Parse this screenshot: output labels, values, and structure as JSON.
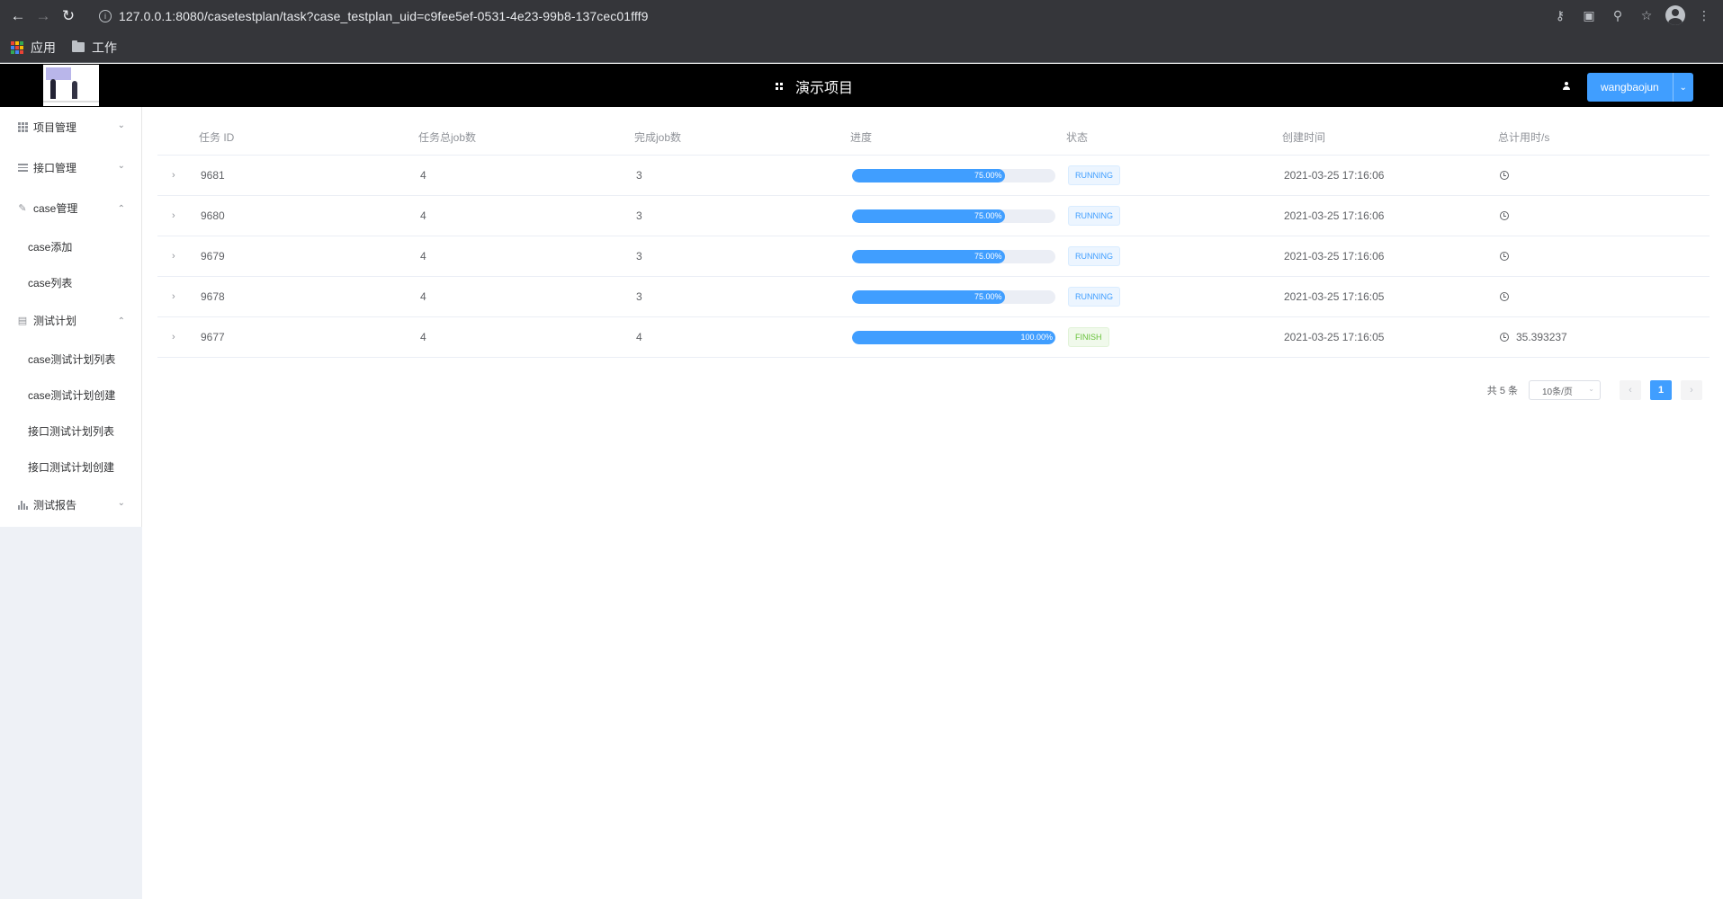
{
  "browser": {
    "url": "127.0.0.1:8080/casetestplan/task?case_testplan_uid=c9fee5ef-0531-4e23-99b8-137cec01fff9",
    "bookmarks": [
      {
        "label": "应用",
        "icon": "apps-grid-icon"
      },
      {
        "label": "工作",
        "icon": "folder-icon"
      }
    ]
  },
  "header": {
    "title": "演示项目",
    "user": "wangbaojun"
  },
  "sidebar": {
    "items": [
      {
        "label": "项目管理",
        "icon": "grid-icon",
        "expanded": false
      },
      {
        "label": "接口管理",
        "icon": "list-icon",
        "expanded": false
      },
      {
        "label": "case管理",
        "icon": "edit-icon",
        "expanded": true,
        "children": [
          "case添加",
          "case列表"
        ]
      },
      {
        "label": "测试计划",
        "icon": "document-icon",
        "expanded": true,
        "children": [
          "case测试计划列表",
          "case测试计划创建",
          "接口测试计划列表",
          "接口测试计划创建"
        ]
      },
      {
        "label": "测试报告",
        "icon": "bar-chart-icon",
        "expanded": false
      }
    ]
  },
  "table": {
    "columns": [
      "任务 ID",
      "任务总job数",
      "完成job数",
      "进度",
      "状态",
      "创建时间",
      "总计用时/s"
    ],
    "rows": [
      {
        "id": "9681",
        "total": "4",
        "done": "3",
        "progress": 75,
        "progress_text": "75.00%",
        "status": "RUNNING",
        "created": "2021-03-25 17:16:06",
        "duration": ""
      },
      {
        "id": "9680",
        "total": "4",
        "done": "3",
        "progress": 75,
        "progress_text": "75.00%",
        "status": "RUNNING",
        "created": "2021-03-25 17:16:06",
        "duration": ""
      },
      {
        "id": "9679",
        "total": "4",
        "done": "3",
        "progress": 75,
        "progress_text": "75.00%",
        "status": "RUNNING",
        "created": "2021-03-25 17:16:06",
        "duration": ""
      },
      {
        "id": "9678",
        "total": "4",
        "done": "3",
        "progress": 75,
        "progress_text": "75.00%",
        "status": "RUNNING",
        "created": "2021-03-25 17:16:05",
        "duration": ""
      },
      {
        "id": "9677",
        "total": "4",
        "done": "4",
        "progress": 100,
        "progress_text": "100.00%",
        "status": "FINISH",
        "created": "2021-03-25 17:16:05",
        "duration": "35.393237"
      }
    ]
  },
  "pagination": {
    "total_text": "共 5 条",
    "page_size": "10条/页",
    "current_page": "1",
    "prev_icon": "‹",
    "next_icon": "›"
  },
  "colors": {
    "primary": "#409eff",
    "running_tag": "#409eff",
    "finish_tag": "#67c23a",
    "header_bg": "#000000",
    "browser_bg": "#35363a"
  }
}
